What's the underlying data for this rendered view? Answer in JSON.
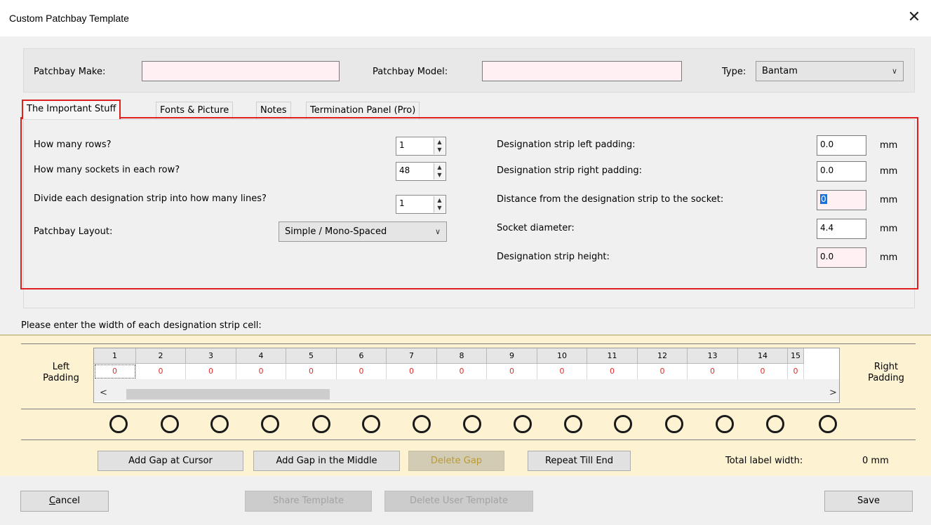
{
  "window": {
    "title": "Custom Patchbay Template",
    "close_glyph": "✕"
  },
  "top": {
    "make_label": "Patchbay Make:",
    "make_value": "",
    "model_label": "Patchbay Model:",
    "model_value": "",
    "type_label": "Type:",
    "type_value": "Bantam"
  },
  "tabs": [
    {
      "label": "The Important Stuff",
      "active": true
    },
    {
      "label": "Fonts & Picture"
    },
    {
      "label": "Notes"
    },
    {
      "label": "Termination Panel (Pro)"
    }
  ],
  "left_fields": {
    "rows_label": "How many rows?",
    "rows_value": "1",
    "sockets_label": "How many sockets in each row?",
    "sockets_value": "48",
    "lines_label": "Divide each designation strip into how many lines?",
    "lines_value": "1",
    "layout_label": "Patchbay Layout:",
    "layout_value": "Simple / Mono-Spaced"
  },
  "right_fields": {
    "left_pad_label": "Designation strip left padding:",
    "left_pad_value": "0.0",
    "right_pad_label": "Designation strip right padding:",
    "right_pad_value": "0.0",
    "distance_label": "Distance from the designation strip to the socket:",
    "distance_value": "0",
    "diameter_label": "Socket diameter:",
    "diameter_value": "4.4",
    "height_label": "Designation strip height:",
    "height_value": "0.0",
    "unit": "mm"
  },
  "strip": {
    "instruction": "Please enter the width of each designation strip cell:",
    "left_padding_label": "Left\nPadding",
    "right_padding_label": "Right\nPadding",
    "columns": [
      "1",
      "2",
      "3",
      "4",
      "5",
      "6",
      "7",
      "8",
      "9",
      "10",
      "11",
      "12",
      "13",
      "14",
      "15"
    ],
    "values": [
      "0",
      "0",
      "0",
      "0",
      "0",
      "0",
      "0",
      "0",
      "0",
      "0",
      "0",
      "0",
      "0",
      "0",
      "0"
    ],
    "scroll_left": "<",
    "scroll_right": ">"
  },
  "actions": {
    "add_gap_cursor": "Add Gap at Cursor",
    "add_gap_middle": "Add Gap in the Middle",
    "delete_gap": "Delete Gap",
    "repeat_till_end": "Repeat Till End",
    "total_label": "Total label width:",
    "total_value": "0 mm"
  },
  "footer": {
    "cancel": "Cancel",
    "share": "Share Template",
    "delete_user": "Delete User Template",
    "save": "Save"
  },
  "colors": {
    "accent_red": "#e01f1f",
    "strip_bg": "#fdf3d2",
    "required_field": "#fff0f3"
  }
}
